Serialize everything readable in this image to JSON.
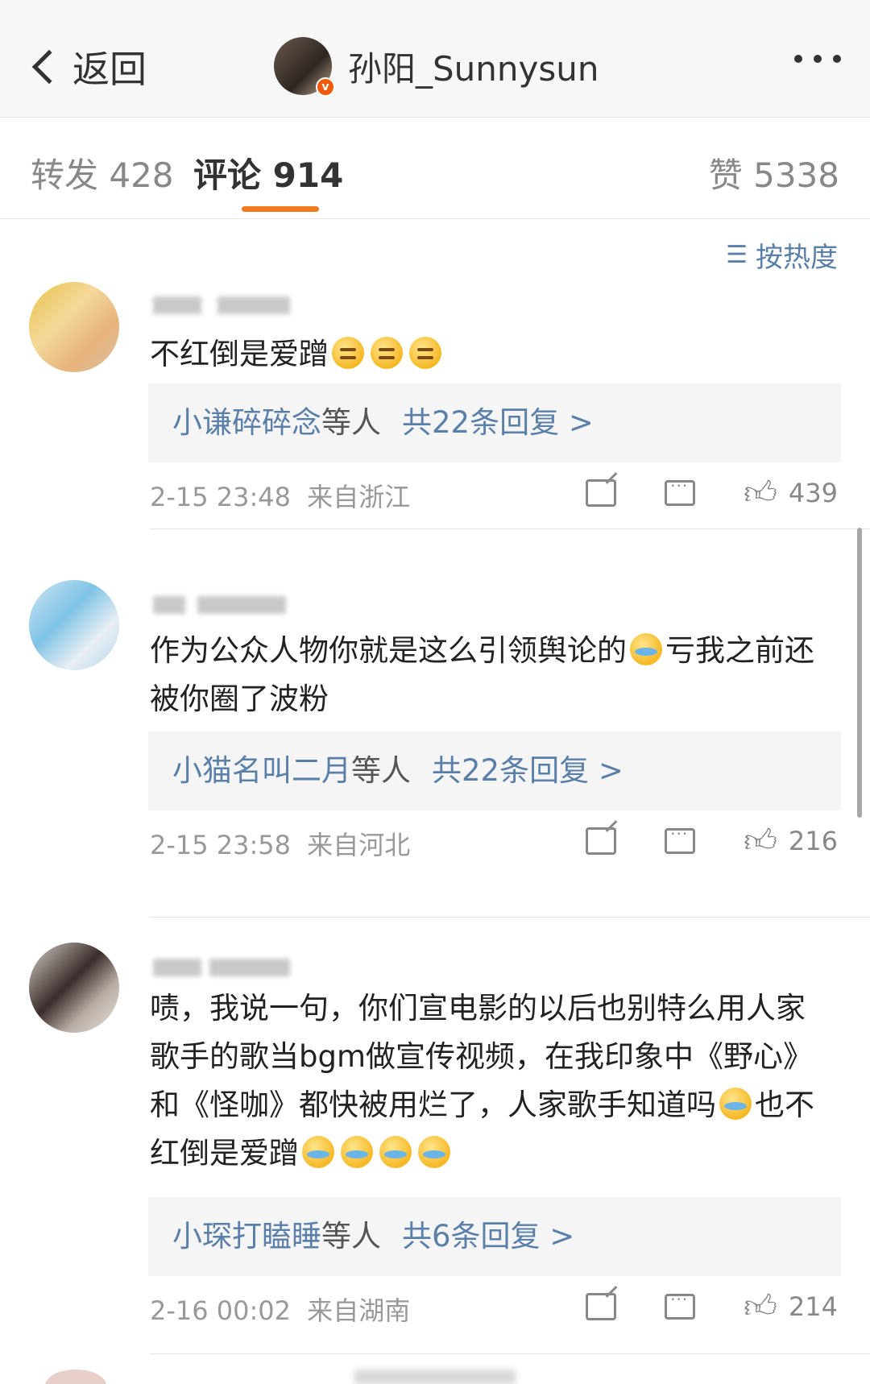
{
  "nav": {
    "back_label": "返回",
    "profile_name": "孙阳_Sunnysun",
    "verified_badge": "v"
  },
  "tabs": {
    "repost": "转发 428",
    "comments": "评论 914",
    "likes": "赞 5338"
  },
  "sort": {
    "icon": "sort-icon",
    "label": "按热度"
  },
  "comments": [
    {
      "text": "不红倒是爱蹭",
      "emojis": [
        "smirk",
        "smirk",
        "smirk"
      ],
      "reply_users": "小谦碎碎念",
      "reply_suffix": "等人",
      "reply_total": "共22条回复 >",
      "time": "2-15 23:48",
      "location": "来自浙江",
      "likes": "439"
    },
    {
      "text_a": "作为公众人物你就是这么引领舆论的",
      "text_b": "亏我之前还被你圈了波粉",
      "emojis": [
        "cry"
      ],
      "reply_users": "小猫名叫二月",
      "reply_suffix": "等人",
      "reply_total": "共22条回复 >",
      "time": "2-15 23:58",
      "location": "来自河北",
      "likes": "216"
    },
    {
      "text_a": "啧，我说一句，你们宣电影的以后也别特么用人家歌手的歌当bgm做宣传视频，在我印象中《野心》和《怪咖》都快被用烂了，人家歌手知道吗",
      "text_b": "也不红倒是爱蹭",
      "emojis": [
        "cry",
        "cry",
        "cry",
        "cry",
        "cry"
      ],
      "reply_users": "小琛打瞌睡",
      "reply_suffix": "等人",
      "reply_total": "共6条回复 >",
      "time": "2-16 00:02",
      "location": "来自湖南",
      "likes": "214"
    }
  ],
  "colors": {
    "accent_orange": "#f27b1d",
    "link_blue": "#5a7fa8",
    "verified_orange": "#f05a0c"
  }
}
